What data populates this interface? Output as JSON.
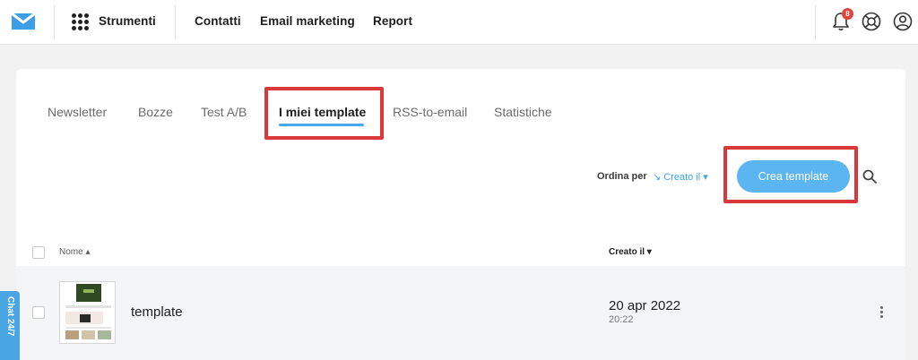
{
  "topbar": {
    "tools_label": "Strumenti",
    "nav": [
      "Contatti",
      "Email marketing",
      "Report"
    ],
    "notification_count": "8",
    "icons": [
      "envelope-logo-icon",
      "apps-grid-icon",
      "bell-icon",
      "lifebuoy-icon",
      "user-icon"
    ]
  },
  "tabs": [
    {
      "label": "Newsletter",
      "active": false
    },
    {
      "label": "Bozze",
      "active": false
    },
    {
      "label": "Test A/B",
      "active": false
    },
    {
      "label": "I miei template",
      "active": true
    },
    {
      "label": "RSS-to-email",
      "active": false
    },
    {
      "label": "Statistiche",
      "active": false
    }
  ],
  "toolbar": {
    "sort_label": "Ordina per",
    "sort_value": "↘ Creato il ▾",
    "create_button": "Crea template"
  },
  "table": {
    "headers": {
      "name": "Nome ▴",
      "created": "Creato il ▾"
    },
    "rows": [
      {
        "name": "template",
        "date": "20 apr 2022",
        "time": "20:22"
      }
    ]
  },
  "chat": {
    "label": "Chat 24/7"
  },
  "colors": {
    "accent": "#46a8ea",
    "button": "#5ab5f0",
    "highlight": "#d9393b",
    "badge": "#e0443a"
  }
}
